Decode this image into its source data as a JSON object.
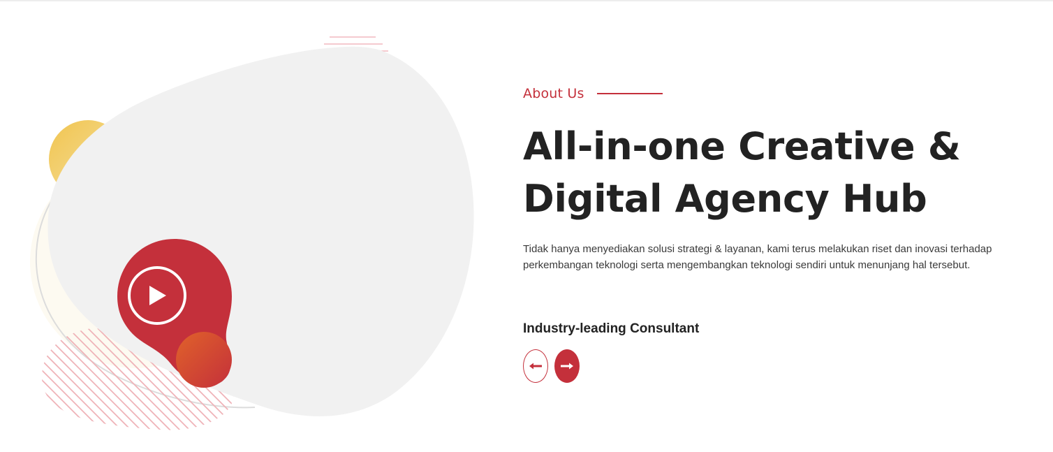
{
  "about": {
    "eyebrow": "About Us",
    "headline_line1": "All-in-one Creative &",
    "headline_line2": "Digital Agency Hub",
    "description": "Tidak hanya menyediakan solusi strategi & layanan, kami terus melakukan riset dan inovasi terhadap perkembangan teknologi serta mengembangkan teknologi sendiri untuk menunjang hal tersebut.",
    "slide_title": "Industry-leading Consultant"
  },
  "slider": {
    "prev_icon": "arrow-left-icon",
    "next_icon": "arrow-right-icon"
  },
  "media": {
    "play_icon": "play-icon"
  },
  "colors": {
    "accent": "#c4303b",
    "heading": "#222222",
    "body": "#3a3a3a",
    "blob": "#f1f1f1",
    "yellow": "#f0c95a",
    "orange": "#e0622a"
  }
}
